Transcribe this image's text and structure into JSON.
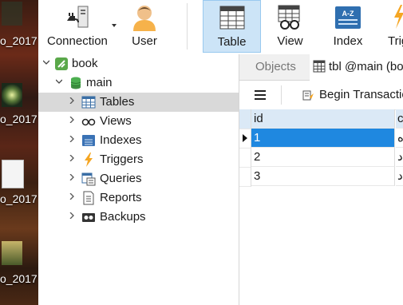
{
  "desktop": {
    "labels": [
      "o_2017",
      "o_2017",
      "o_2017",
      "o_2017"
    ]
  },
  "toolbar": {
    "buttons": [
      {
        "label": "Connection",
        "icon": "connection-icon"
      },
      {
        "label": "User",
        "icon": "user-icon"
      },
      {
        "label": "Table",
        "icon": "table-icon",
        "active": true
      },
      {
        "label": "View",
        "icon": "view-icon"
      },
      {
        "label": "Index",
        "icon": "index-icon"
      },
      {
        "label": "Trig",
        "icon": "trigger-icon"
      }
    ],
    "index_icon_text": "A-Z",
    "accent": "#cce4f7"
  },
  "tree": {
    "connection": "book",
    "database": "main",
    "items": [
      {
        "label": "Tables",
        "icon": "tables-icon",
        "selected": true
      },
      {
        "label": "Views",
        "icon": "views-icon"
      },
      {
        "label": "Indexes",
        "icon": "indexes-icon"
      },
      {
        "label": "Triggers",
        "icon": "triggers-icon"
      },
      {
        "label": "Queries",
        "icon": "queries-icon"
      },
      {
        "label": "Reports",
        "icon": "reports-icon"
      },
      {
        "label": "Backups",
        "icon": "backups-icon"
      }
    ]
  },
  "tabs": {
    "objects": "Objects",
    "table_tab": "tbl @main (bo"
  },
  "subbar": {
    "begin_transaction": "Begin Transactio"
  },
  "grid": {
    "columns": [
      "id",
      "c"
    ],
    "rows": [
      {
        "id": "1",
        "c": "ه"
      },
      {
        "id": "2",
        "c": "د"
      },
      {
        "id": "3",
        "c": "د"
      }
    ],
    "current_row_color": "#1f88e0"
  }
}
